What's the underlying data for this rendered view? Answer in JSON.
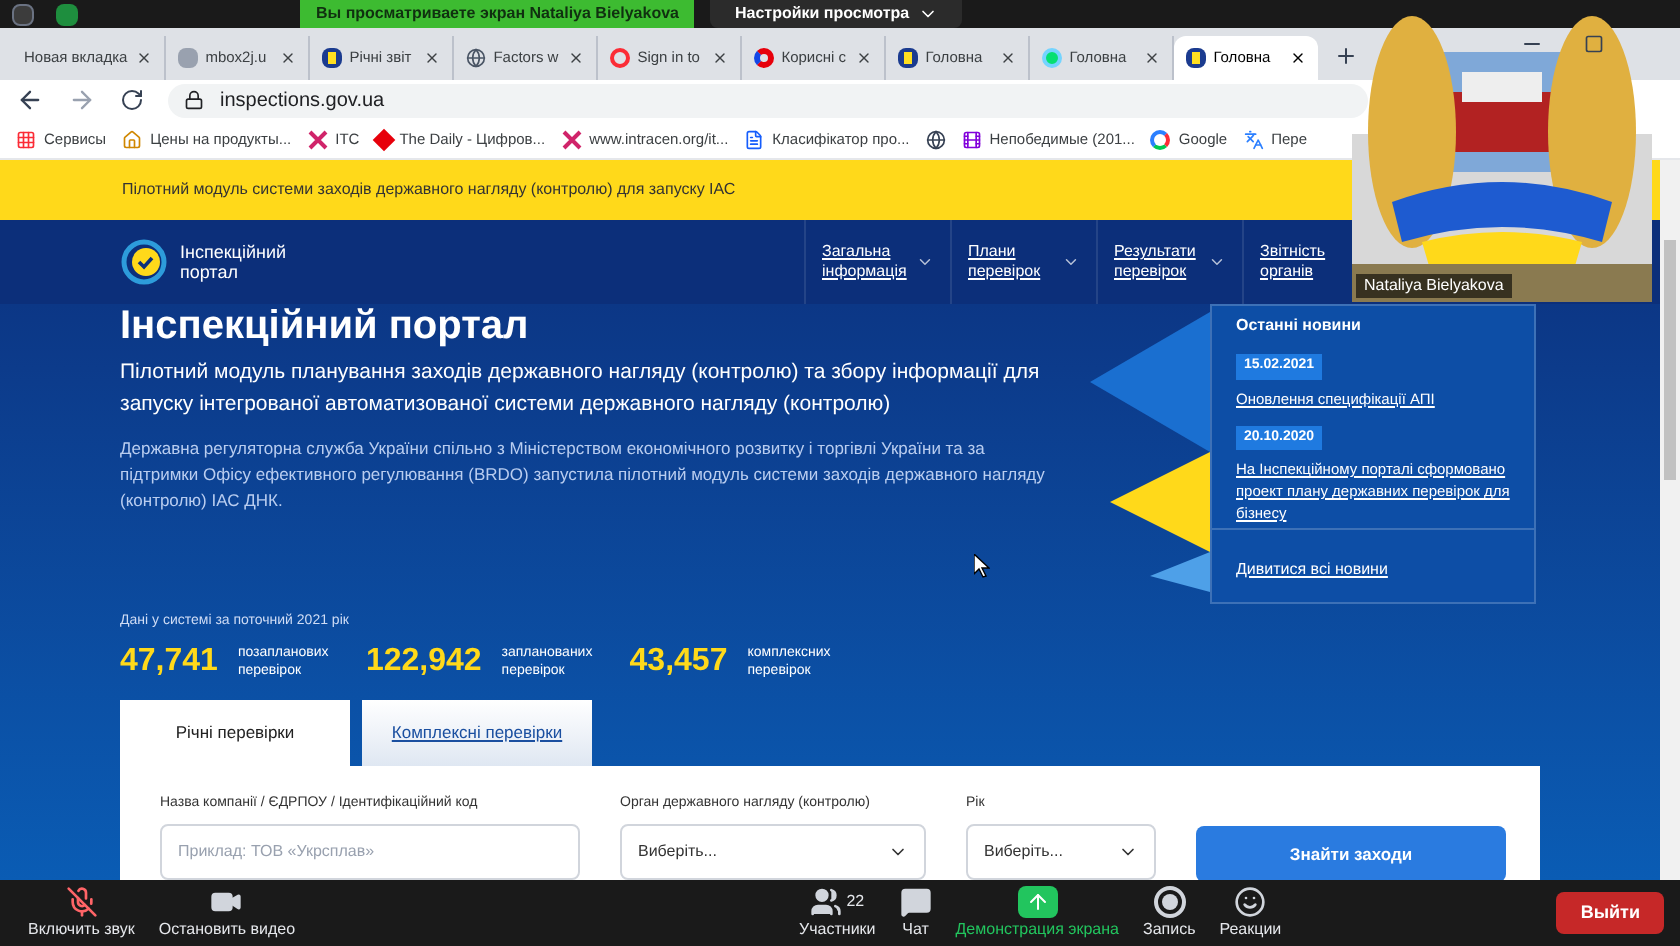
{
  "share_banner": {
    "text": "Вы просматриваете экран Nataliya Bielyakova",
    "view_settings": "Настройки просмотра"
  },
  "browser_tabs": [
    {
      "label": "Новая вкладка",
      "kind": "blank",
      "selected": false
    },
    {
      "label": "mbox2j.u",
      "kind": "page",
      "selected": false
    },
    {
      "label": "Річні звіт",
      "kind": "trident",
      "selected": false
    },
    {
      "label": "Factors w",
      "kind": "globe",
      "selected": false
    },
    {
      "label": "Sign in to",
      "kind": "target",
      "selected": false
    },
    {
      "label": "Корисні с",
      "kind": "ring",
      "selected": false
    },
    {
      "label": "Головна",
      "kind": "trident",
      "selected": false
    },
    {
      "label": "Головна",
      "kind": "dot",
      "selected": false
    },
    {
      "label": "Головна",
      "kind": "trident",
      "selected": true
    }
  ],
  "address": "inspections.gov.ua",
  "bookmarks": [
    {
      "label": "Сервисы",
      "kind": "apps"
    },
    {
      "label": "Цены на продукты...",
      "kind": "home"
    },
    {
      "label": "ITC",
      "kind": "cross"
    },
    {
      "label": "The Daily - Цифров...",
      "kind": "maple"
    },
    {
      "label": "www.intracen.org/it...",
      "kind": "cross"
    },
    {
      "label": "Класифікатор про...",
      "kind": "doc"
    },
    {
      "kind": "globe"
    },
    {
      "label": "Непобедимые (201...",
      "kind": "film"
    },
    {
      "label": "Google",
      "kind": "google"
    },
    {
      "label": "Пере",
      "kind": "translate"
    }
  ],
  "site": {
    "banner": "Пілотний модуль системи заходів державного нагляду (контролю) для запуску ІАС",
    "logo_text": "Інспекційний портал",
    "nav": [
      {
        "label": "Загальна інформація",
        "dropdown": true
      },
      {
        "label": "Плани перевірок",
        "dropdown": true
      },
      {
        "label": "Результати перевірок",
        "dropdown": true
      },
      {
        "label": "Звітність органів"
      }
    ],
    "heading": "Інспекційний портал",
    "subtitle": "Пілотний модуль планування заходів державного нагляду (контролю) та збору інформації для запуску інтегрованої автоматизованої системи державного нагляду (контролю)",
    "description": "Державна регуляторна служба України спільно з Міністерством економічного розвитку і торгівлі України та за підтримки Офісу ефективного регулювання (BRDO) запустила пілотний модуль системи заходів державного нагляду (контролю) ІАС ДНК.",
    "stats_caption": "Дані у системі за поточний 2021 рік",
    "stats": [
      {
        "value": "47,741",
        "label": "позапланових перевірок"
      },
      {
        "value": "122,942",
        "label": "запланованих перевірок"
      },
      {
        "value": "43,457",
        "label": "комплексних перевірок"
      }
    ],
    "news": {
      "title": "Останні новини",
      "items": [
        {
          "date": "15.02.2021",
          "title": "Оновлення специфікації АПІ"
        },
        {
          "date": "20.10.2020",
          "title": "На Інспекційному порталі сформовано проект плану державних перевірок для бізнесу"
        }
      ],
      "all_link": "Дивитися всі новини"
    },
    "search_tabs": [
      {
        "label": "Річні перевірки",
        "selected": true
      },
      {
        "label": "Комплексні перевірки",
        "selected": false
      }
    ],
    "form": {
      "company_label": "Назва компанії / ЄДРПОУ / Ідентифікаційний код",
      "company_placeholder": "Приклад: ТОВ «Укрсплав»",
      "authority_label": "Орган державного нагляду (контролю)",
      "authority_value": "Виберіть...",
      "year_label": "Рік",
      "year_value": "Виберіть...",
      "submit": "Знайти заходи"
    }
  },
  "video": {
    "name": "Nataliya Bielyakova"
  },
  "zoom_toolbar": [
    {
      "label": "Включить звук",
      "kind": "mic-off",
      "active": false
    },
    {
      "label": "Остановить видео",
      "kind": "video",
      "active": false
    },
    {
      "label": "Участники",
      "kind": "people",
      "count": "22",
      "active": false
    },
    {
      "label": "Чат",
      "kind": "chat",
      "active": false
    },
    {
      "label": "Демонстрация экрана",
      "kind": "share",
      "active": true
    },
    {
      "label": "Запись",
      "kind": "record",
      "active": false
    },
    {
      "label": "Реакции",
      "kind": "smile",
      "active": false
    }
  ],
  "leave": "Выйти"
}
